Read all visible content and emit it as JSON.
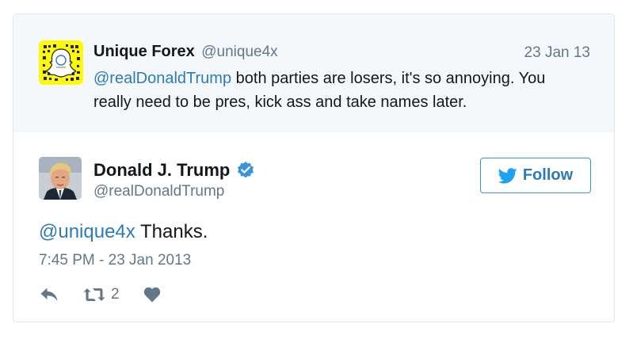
{
  "quoted_tweet": {
    "avatar_name": "snapcode-avatar",
    "display_name": "Unique Forex",
    "handle": "@unique4x",
    "date": "23 Jan 13",
    "mention": "@realDonaldTrump",
    "text": " both parties are losers, it's so annoying. You really need to be pres, kick ass and take names later."
  },
  "main_tweet": {
    "display_name": "Donald J. Trump",
    "handle": "@realDonaldTrump",
    "verified": true,
    "follow_label": "Follow",
    "mention": "@unique4x",
    "text": " Thanks.",
    "timestamp": "7:45 PM - 23 Jan 2013",
    "retweet_count": "2"
  },
  "colors": {
    "link": "#2b7bb9",
    "verified_badge": "#3b94d9",
    "quoted_background": "#f5f8fa",
    "muted": "#657786"
  }
}
